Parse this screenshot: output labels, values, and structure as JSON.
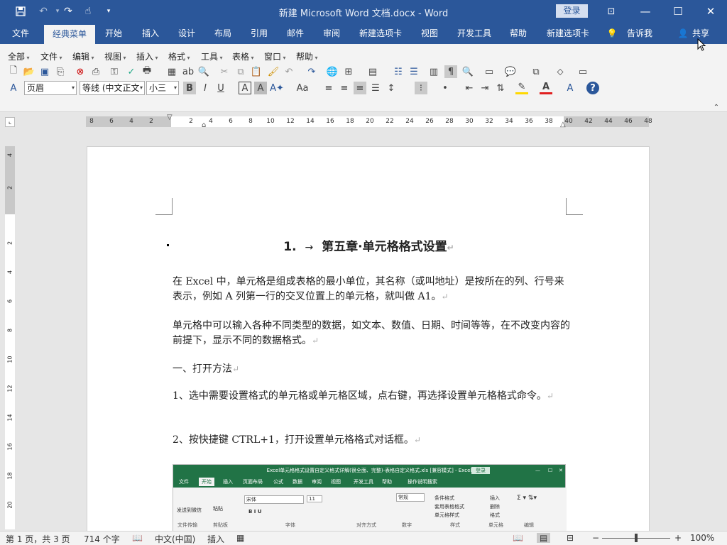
{
  "titlebar": {
    "doc_title": "新建 Microsoft Word 文档.docx - Word",
    "login": "登录",
    "icons": [
      "save-icon",
      "undo-icon",
      "redo-icon",
      "touch-mode-icon",
      "customize-icon"
    ]
  },
  "tabs": [
    "文件",
    "经典菜单",
    "开始",
    "插入",
    "设计",
    "布局",
    "引用",
    "邮件",
    "审阅",
    "新建选项卡",
    "视图",
    "开发工具",
    "帮助",
    "新建选项卡"
  ],
  "active_tab": "经典菜单",
  "tell_me": "告诉我",
  "share": "共享",
  "classic_menus": [
    "全部",
    "文件",
    "编辑",
    "视图",
    "插入",
    "格式",
    "工具",
    "表格",
    "窗口",
    "帮助"
  ],
  "format_bar": {
    "style": "页眉",
    "font": "等线 (中文正文",
    "size": "小三",
    "bold": "B",
    "italic": "I",
    "underline": "U",
    "char_border": "A",
    "char_shade": "A",
    "font_size_toggle": "Aa"
  },
  "ruler": {
    "numbers": [
      "8",
      "6",
      "4",
      "2",
      "2",
      "4",
      "6",
      "8",
      "10",
      "12",
      "14",
      "16",
      "18",
      "20",
      "22",
      "24",
      "26",
      "28",
      "30",
      "32",
      "34",
      "36",
      "38",
      "40",
      "42",
      "44",
      "46",
      "48"
    ],
    "vnumbers": [
      "4",
      "2",
      "2",
      "4",
      "6",
      "8",
      "10",
      "12",
      "14",
      "16",
      "18",
      "20"
    ]
  },
  "document": {
    "heading_num": "1.",
    "heading_arrow": "→",
    "heading_text": "第五章·单元格格式设置",
    "para1": "在 Excel 中，单元格是组成表格的最小单位，其名称（或叫地址）是按所在的列、行号来表示，例如 A 列第一行的交叉位置上的单元格，就叫做 A1。",
    "para2": "单元格中可以输入各种不同类型的数据，如文本、数值、日期、时间等等，在不改变内容的前提下，显示不同的数据格式。",
    "para3": "一、打开方法",
    "para4": "1、选中需要设置格式的单元格或单元格区域，点右键，再选择设置单元格格式命令。",
    "para5": "2、按快捷键 CTRL+1，打开设置单元格格式对话框。",
    "pilcrow": "↵"
  },
  "embedded_excel": {
    "title": "Excel单元格格式设置自定义格式详解(很全面、完整)-表格自定义格式.xls [兼容模式] - Excel",
    "login": "登录",
    "tabs": [
      "文件",
      "开始",
      "插入",
      "页面布局",
      "公式",
      "数据",
      "审阅",
      "视图",
      "开发工具",
      "帮助",
      "操作说明搜索"
    ],
    "active_tab": "开始",
    "groups": [
      "文件传输",
      "剪贴板",
      "字体",
      "对齐方式",
      "数字",
      "样式",
      "单元格",
      "编辑"
    ],
    "send_label": "发送到微信",
    "paste_label": "粘贴",
    "font": "宋体",
    "size": "11",
    "number_format": "常规",
    "cond_format": "条件格式",
    "table_format": "套用表格格式",
    "cell_style": "单元格样式",
    "insert": "插入",
    "delete": "删除",
    "format": "格式"
  },
  "statusbar": {
    "page": "第 1 页，共 3 页",
    "words": "714 个字",
    "language": "中文(中国)",
    "mode": "插入",
    "zoom": "100%"
  },
  "colors": {
    "word_blue": "#2b579a",
    "excel_green": "#217346",
    "highlight_yellow": "#ffd800",
    "font_red": "#e02020"
  }
}
